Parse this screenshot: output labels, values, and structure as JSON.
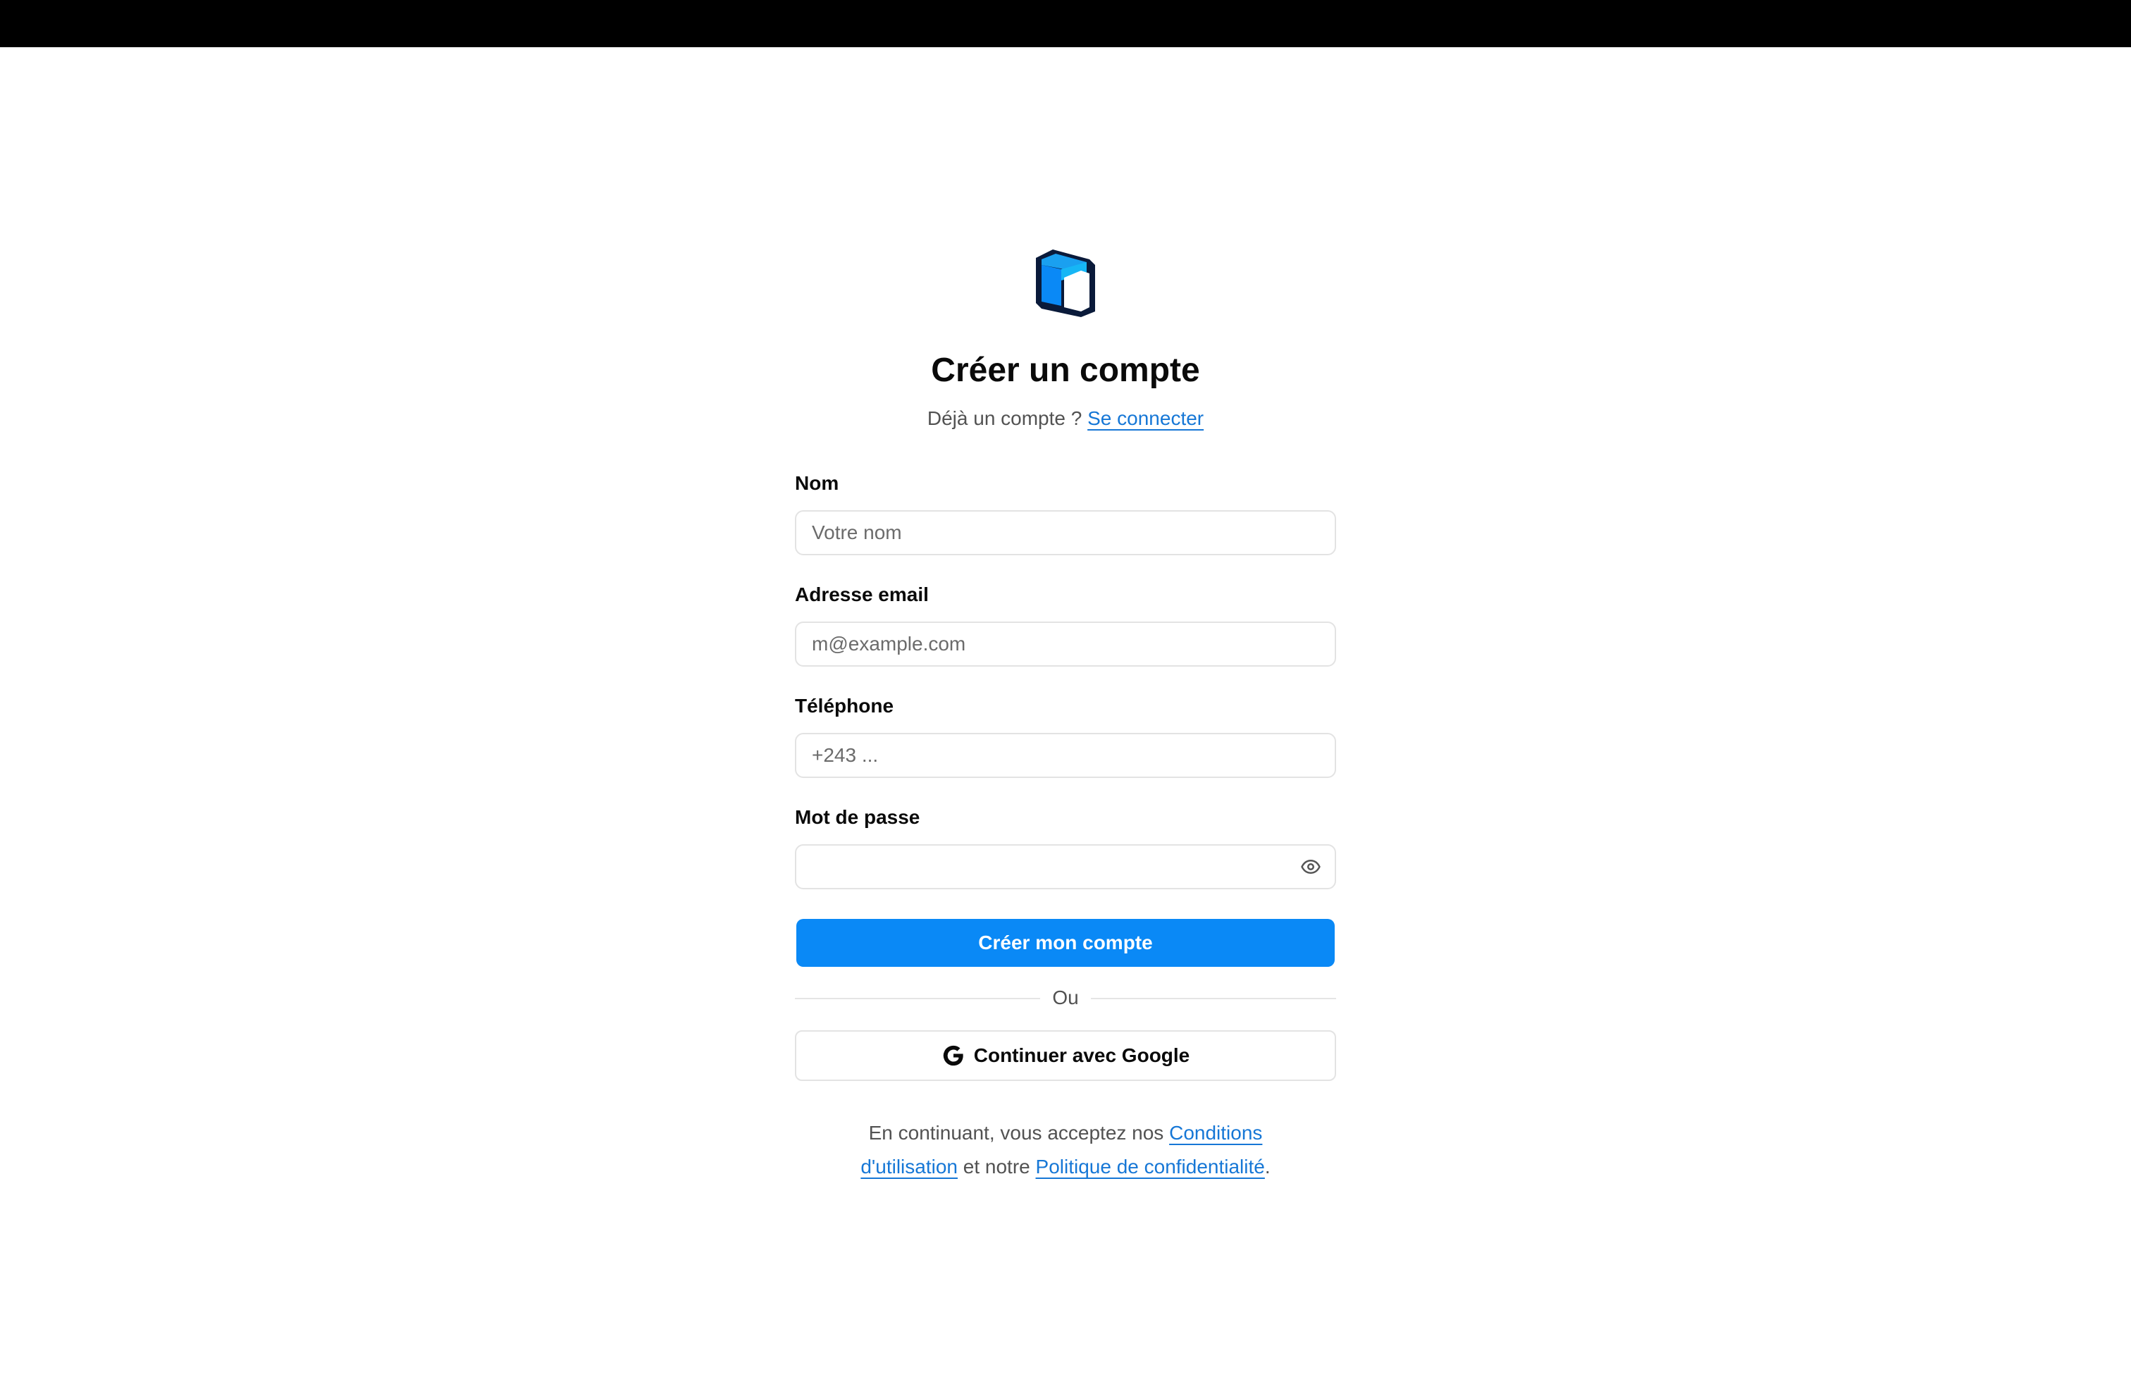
{
  "header": {
    "title": "Créer un compte",
    "subtitle_prefix": "Déjà un compte ?",
    "signin_link": "Se connecter"
  },
  "logo": {
    "icon": "cube-logo-icon",
    "colors": [
      "#0a1a3a",
      "#1aa0f0",
      "#0a89f6",
      "#ffffff"
    ]
  },
  "form": {
    "name": {
      "label": "Nom",
      "placeholder": "Votre nom",
      "value": ""
    },
    "email": {
      "label": "Adresse email",
      "placeholder": "m@example.com",
      "value": ""
    },
    "phone": {
      "label": "Téléphone",
      "placeholder": "+243 ...",
      "value": ""
    },
    "password": {
      "label": "Mot de passe",
      "placeholder": "",
      "value": "",
      "toggle_icon": "eye-icon"
    },
    "submit_label": "Créer mon compte"
  },
  "divider": {
    "label": "Ou"
  },
  "google": {
    "label": "Continuer avec Google",
    "icon": "google-g-icon"
  },
  "terms": {
    "prefix": "En continuant, vous acceptez nos",
    "tos_link": "Conditions d'utilisation",
    "middle": "et notre",
    "privacy_link": "Politique de confidentialité",
    "suffix": "."
  },
  "colors": {
    "accent": "#0a89f6",
    "link": "#1677d6",
    "top_bar": "#000000"
  }
}
